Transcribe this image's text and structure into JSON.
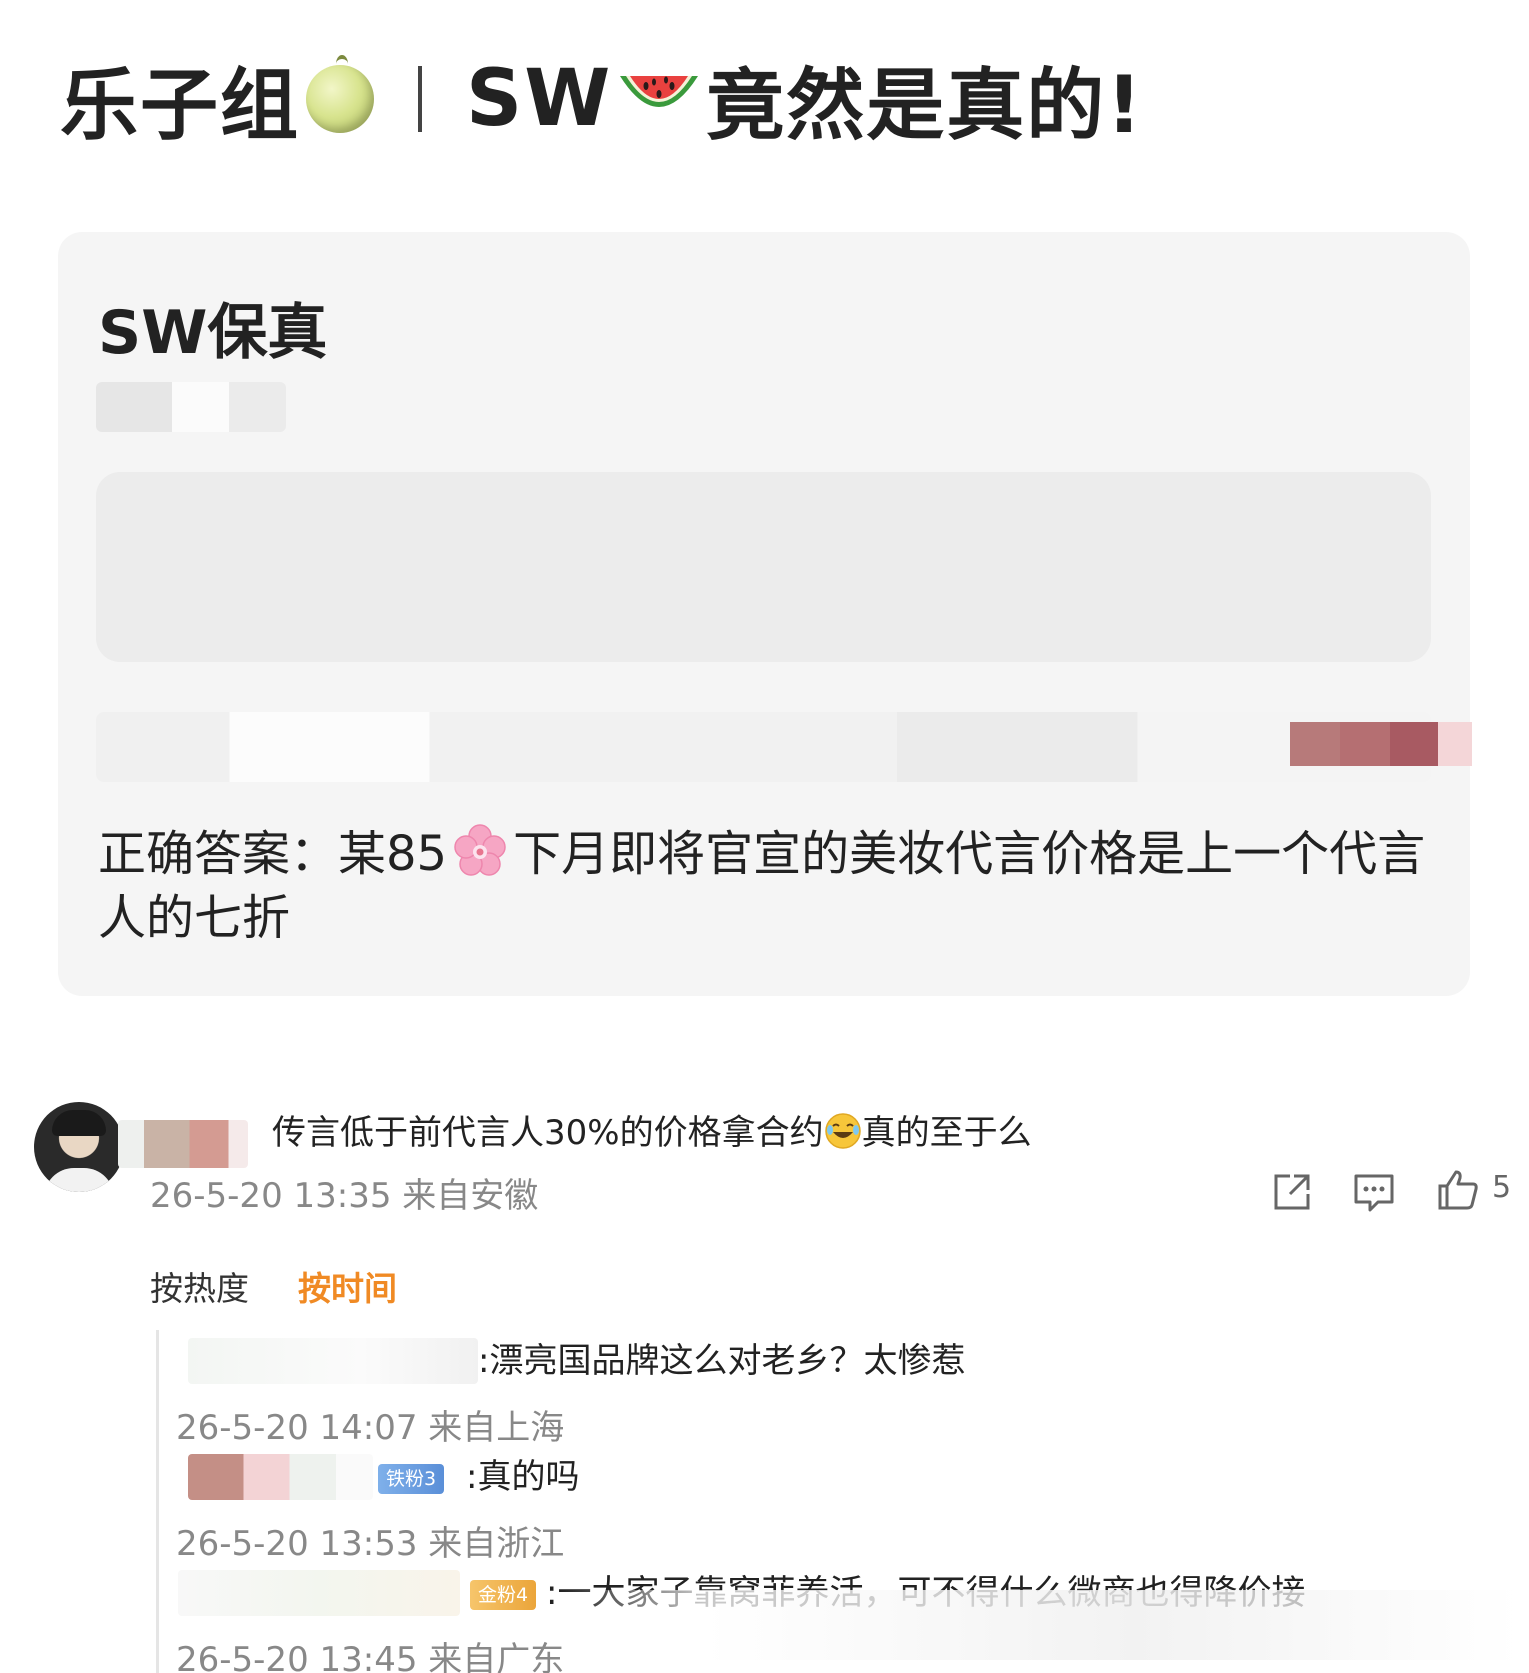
{
  "headline": {
    "left_text": "乐子组",
    "left_icon": "melon-icon",
    "right_text_a": "SW",
    "right_icon": "watermelon-icon",
    "right_text_b": "竟然是真的!"
  },
  "card": {
    "title": "SW保真",
    "answer_prefix": "正确答案：某85",
    "answer_icon": "cherry-blossom-icon",
    "answer_suffix": "下月即将官宣的美妆代言价格是上一个代言人的七折"
  },
  "main_comment": {
    "text_a": "传言低于前代言人30%的价格拿合约",
    "emoji": "laughing-tears-icon",
    "text_b": "真的至于么",
    "meta": "26-5-20 13:35 来自安徽",
    "like_count": "5"
  },
  "sort": {
    "hot_label": "按热度",
    "time_label": "按时间",
    "active": "time"
  },
  "replies": [
    {
      "text": ":漂亮国品牌这么对老乡？太惨惹",
      "meta": "26-5-20 14:07 来自上海"
    },
    {
      "badge": "铁粉3",
      "text": ":真的吗",
      "meta": "26-5-20 13:53 来自浙江"
    },
    {
      "badge": "金粉4",
      "text": ":一大家子靠窝菲养活，可不得什么微商也得降价接",
      "meta": "26-5-20 13:45 来自广东"
    }
  ],
  "colors": {
    "accent_orange": "#f08a24",
    "card_bg": "#f5f5f5",
    "meta_gray": "#888888",
    "iron_badge": "#5a8fd8",
    "gold_badge": "#eba53a"
  }
}
